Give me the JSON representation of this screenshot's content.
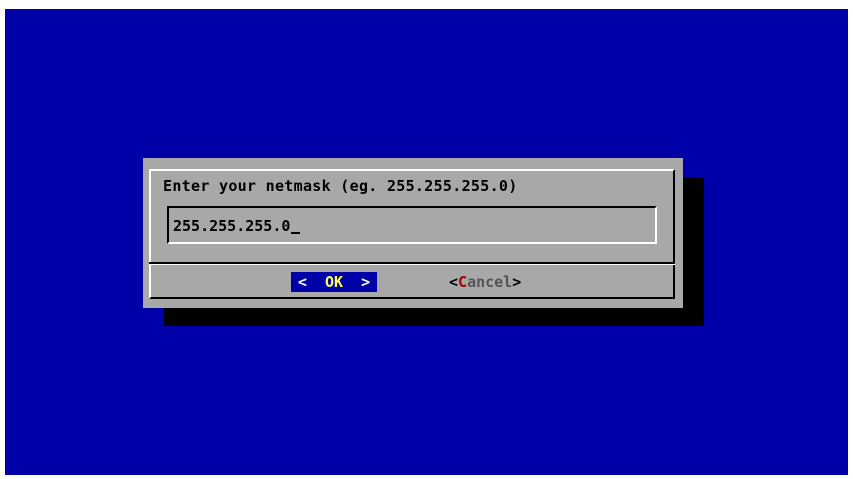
{
  "dialog": {
    "prompt": "Enter your netmask (eg. 255.255.255.0)",
    "input_value": "255.255.255.0"
  },
  "buttons": {
    "ok": {
      "left": "<",
      "hot": "OK",
      "right": ">"
    },
    "cancel": {
      "open": "<",
      "hot": "C",
      "rest": "ancel",
      "close": ">"
    }
  },
  "colors": {
    "background": "#0000a8",
    "dialog": "#a8a8a8",
    "shadow": "#000000",
    "focus_button_bg": "#0000a8",
    "hotkey_yellow": "#ffff54",
    "hotkey_red": "#a80000"
  }
}
